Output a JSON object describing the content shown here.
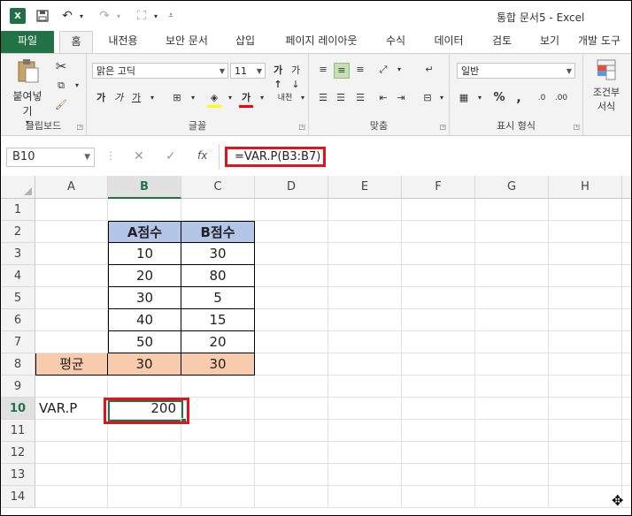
{
  "titlebar": {
    "app_icon": "X",
    "doc_title": "통합 문서5 - Excel"
  },
  "tabs": [
    {
      "label": "파일",
      "key": "file"
    },
    {
      "label": "홈",
      "key": "home",
      "active": true
    },
    {
      "label": "내전용"
    },
    {
      "label": "보안 문서"
    },
    {
      "label": "삽입"
    },
    {
      "label": "페이지 레이아웃"
    },
    {
      "label": "수식"
    },
    {
      "label": "데이터"
    },
    {
      "label": "검토"
    },
    {
      "label": "보기"
    },
    {
      "label": "개발 도구"
    }
  ],
  "ribbon": {
    "clipboard": {
      "paste_label": "붙여넣기",
      "group_label": "클립보드"
    },
    "font": {
      "font_name": "맑은 고딕",
      "font_size": "11",
      "group_label": "글꼴",
      "bold": "가",
      "italic": "가",
      "underline": "가",
      "font_color_glyph": "가",
      "phonetic": "내천"
    },
    "alignment": {
      "group_label": "맞춤"
    },
    "number": {
      "format": "일반",
      "percent": "%",
      "comma": ",",
      "group_label": "표시 형식"
    },
    "styles": {
      "conditional_label_1": "조건부",
      "conditional_label_2": "서식"
    }
  },
  "formula_bar": {
    "name_box": "B10",
    "fx": "fx",
    "formula": "=VAR.P(B3:B7)"
  },
  "grid": {
    "columns": [
      "A",
      "B",
      "C",
      "D",
      "E",
      "F",
      "G",
      "H"
    ],
    "selected_column": "B",
    "rows": [
      "1",
      "2",
      "3",
      "4",
      "5",
      "6",
      "7",
      "8",
      "9",
      "10",
      "11",
      "12",
      "13",
      "14"
    ],
    "selected_row": "10",
    "table_headers": [
      "A점수",
      "B점수"
    ],
    "table_rows": [
      [
        "10",
        "30"
      ],
      [
        "20",
        "80"
      ],
      [
        "30",
        "5"
      ],
      [
        "40",
        "15"
      ],
      [
        "50",
        "20"
      ]
    ],
    "avg_label": "평균",
    "avg_values": [
      "30",
      "30"
    ],
    "result_label": "VAR.P",
    "result_value": "200"
  },
  "colors": {
    "excel_green": "#217346",
    "header_fill": "#b4c6e7",
    "avg_fill": "#f8cbad",
    "highlight_red": "#e3131b"
  }
}
